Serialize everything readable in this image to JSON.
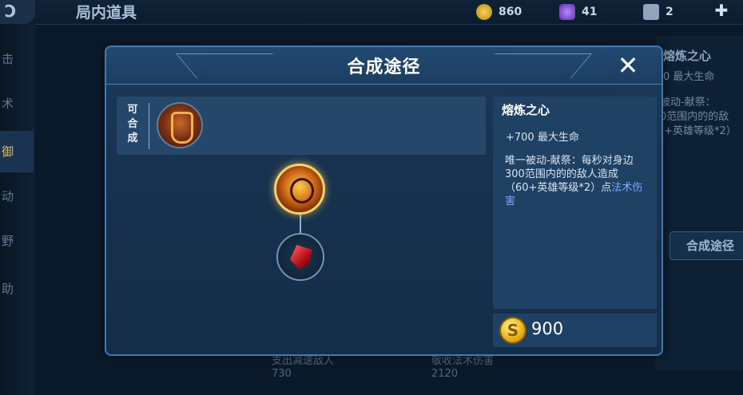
{
  "background": {
    "title": "局内道具",
    "resources": {
      "gold": "860",
      "gems": "41",
      "tickets": "2"
    },
    "side_tabs": [
      "击",
      "术",
      "御",
      "动",
      "野",
      "助"
    ],
    "right_name": "熔炼之心",
    "right_stat": "0 最大生命",
    "right_desc": "被动-献祭：\n0范围内的的敌\n)+英雄等级*2）",
    "right_button": "合成途径",
    "bottom_1": "支出减速敌人\n730",
    "bottom_2": "敬收法术伤害\n2120"
  },
  "modal": {
    "title": "合成途径",
    "close_symbol": "✕",
    "craft_label": "可\n合\n成",
    "item_name": "熔炼之心",
    "item_stat": "+700 最大生命",
    "item_desc_prefix": "唯一被动-献祭：每秒对身边300范围内的的敌人造成（60+英雄等级*2）点",
    "item_desc_magic": "法术伤害",
    "coin_symbol": "S",
    "price": "900"
  },
  "colors": {
    "accent_blue": "#3f7ab0",
    "gold": "#f2c12c",
    "magic_text": "#7fa8ff"
  }
}
